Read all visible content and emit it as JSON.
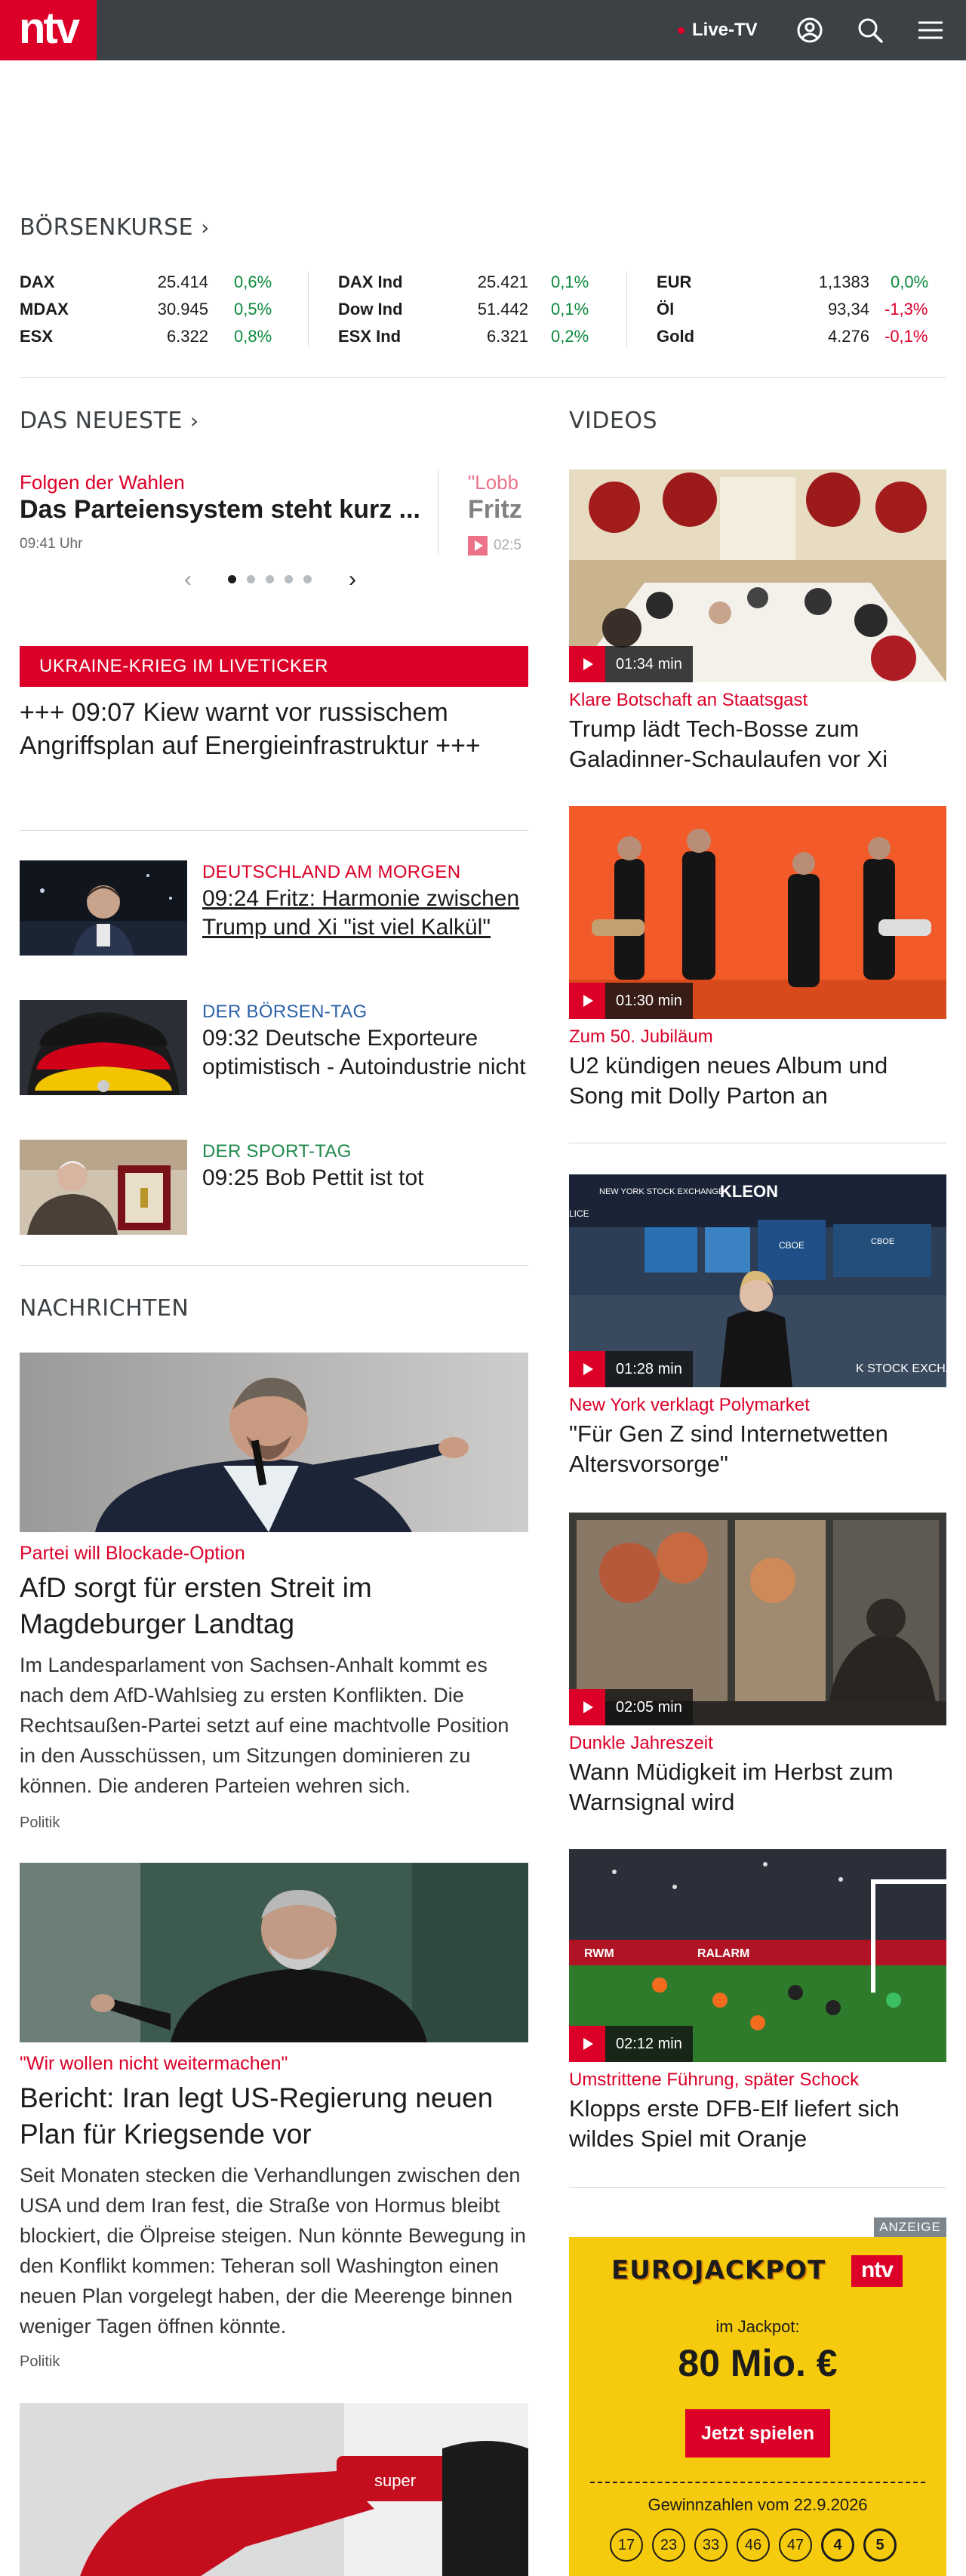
{
  "header": {
    "logo": "ntv",
    "live_label": "Live-TV",
    "icons": [
      "user-icon",
      "search-icon",
      "menu-icon"
    ]
  },
  "boersenkurse": {
    "title": "BÖRSENKURSE",
    "columns": [
      [
        {
          "name": "DAX",
          "value": "25.414",
          "change": "0,6%"
        },
        {
          "name": "MDAX",
          "value": "30.945",
          "change": "0,5%"
        },
        {
          "name": "ESX",
          "value": "6.322",
          "change": "0,8%"
        }
      ],
      [
        {
          "name": "DAX Ind",
          "value": "25.421",
          "change": "0,1%"
        },
        {
          "name": "Dow Ind",
          "value": "51.442",
          "change": "0,1%"
        },
        {
          "name": "ESX Ind",
          "value": "6.321",
          "change": "0,2%"
        }
      ],
      [
        {
          "name": "EUR",
          "value": "1,1383",
          "change": "0,0%"
        },
        {
          "name": "Öl",
          "value": "93,34",
          "change": "-1,3%"
        },
        {
          "name": "Gold",
          "value": "4.276",
          "change": "-0,1%"
        }
      ]
    ],
    "colors": {
      "positive": "#0b8a3c",
      "negative": "#dc0028"
    }
  },
  "neueste": {
    "title": "DAS NEUESTE",
    "slides": [
      {
        "kicker": "Folgen der Wahlen",
        "headline": "Das Parteiensystem steht kurz ...",
        "time": "09:41 Uhr"
      },
      {
        "kicker": "\"Lobb",
        "headline": "Fritz",
        "time": "02:5"
      }
    ],
    "active_dot": 1,
    "dot_count": 5
  },
  "ticker": {
    "label": "UKRAINE-KRIEG IM LIVETICKER",
    "text": "+++ 09:07 Kiew warnt vor russischem Angriffsplan auf Energieinfrastruktur +++"
  },
  "teasers": [
    {
      "kicker": "DEUTSCHLAND AM MORGEN",
      "headline": "09:24 Fritz: Harmonie zwischen Trump und Xi \"ist viel Kalkül\"",
      "kicker_color": "#dc0028"
    },
    {
      "kicker": "DER BÖRSEN-TAG",
      "headline": "09:32 Deutsche Exporteure optimistisch - Autoindustrie nicht",
      "kicker_color": "#2c63a8"
    },
    {
      "kicker": "DER SPORT-TAG",
      "headline": "09:25 Bob Pettit ist tot",
      "kicker_color": "#1f8a4c"
    }
  ],
  "nachrichten": {
    "title": "NACHRICHTEN",
    "articles": [
      {
        "kicker": "Partei will Blockade-Option",
        "headline": "AfD sorgt für ersten Streit im Magdeburger Landtag",
        "text": "Im Landesparlament von Sachsen-Anhalt kommt es nach dem AfD-Wahlsieg zu ersten Konflikten. Die Rechtsaußen-Partei setzt auf eine machtvolle Position in den Ausschüssen, um Sitzungen dominieren zu können. Die anderen Parteien wehren sich.",
        "category": "Politik"
      },
      {
        "kicker": "\"Wir wollen nicht weitermachen\"",
        "headline": "Bericht: Iran legt US-Regierung neuen Plan für Kriegsende vor",
        "text": "Seit Monaten stecken die Verhandlungen zwischen den USA und dem Iran fest, die Straße von Hormus bleibt blockiert, die Ölpreise steigen. Nun könnte Bewegung in den Konflikt kommen: Teheran soll Washington einen neuen Plan vorgelegt haben, der die Meerenge binnen weniger Tagen öffnen könnte.",
        "category": "Politik"
      }
    ]
  },
  "videos": {
    "title": "VIDEOS",
    "items": [
      {
        "duration": "01:34 min",
        "kicker": "Klare Botschaft an Staatsgast",
        "headline": "Trump lädt Tech-Bosse zum Galadinner-Schaulaufen vor Xi"
      },
      {
        "duration": "01:30 min",
        "kicker": "Zum 50. Jubiläum",
        "headline": "U2 kündigen neues Album und Song mit Dolly Parton an"
      },
      {
        "duration": "01:28 min",
        "kicker": "New York verklagt Polymarket",
        "headline": "\"Für Gen Z sind Internetwetten Altersvorsorge\""
      },
      {
        "duration": "02:05 min",
        "kicker": "Dunkle Jahreszeit",
        "headline": "Wann Müdigkeit im Herbst zum Warnsignal wird"
      },
      {
        "duration": "02:12 min",
        "kicker": "Umstrittene Führung, später Schock",
        "headline": "Klopps erste DFB-Elf liefert sich wildes Spiel mit Oranje"
      }
    ]
  },
  "ad": {
    "label": "ANZEIGE",
    "brand": "EUROJACKPOT",
    "logo": "ntv",
    "jackpot_label": "im Jackpot:",
    "jackpot_value": "80 Mio. €",
    "cta": "Jetzt spielen",
    "numbers_label": "Gewinnzahlen vom 22.9.2026",
    "numbers": [
      "17",
      "23",
      "33",
      "46",
      "47"
    ],
    "euro_numbers": [
      "4",
      "5"
    ]
  },
  "image_texts": {
    "stock_exchange_sign": "NEW YORK STOCK EXCHANGE",
    "stock_exchange_logo": "KLEON",
    "stock_exchange_screen": "CBOE",
    "stock_exchange_screen2": "CBOE",
    "stock_exchange_wall": "K STOCK EXCHANGE",
    "stock_exchange_wall_left": "LICE",
    "stadium_banner": "RALARM",
    "stadium_banner2": "RWM",
    "fuel_nozzle": "super"
  }
}
